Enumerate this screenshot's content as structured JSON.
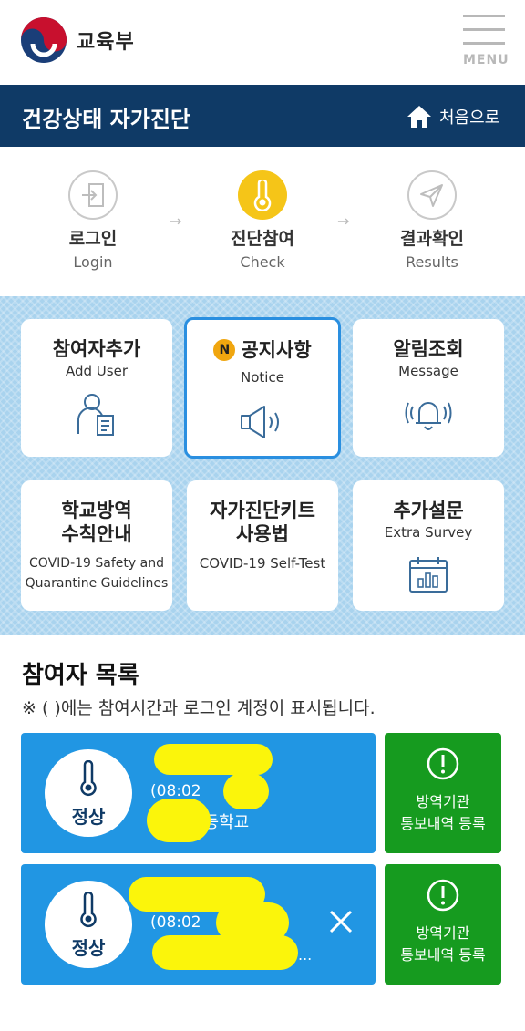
{
  "header": {
    "brand": "교육부",
    "menu_label": "MENU"
  },
  "titlebar": {
    "title": "건강상태 자가진단",
    "home_label": "처음으로"
  },
  "steps": [
    {
      "ko": "로그인",
      "en": "Login"
    },
    {
      "ko": "진단참여",
      "en": "Check"
    },
    {
      "ko": "결과확인",
      "en": "Results"
    }
  ],
  "step_arrow": "→",
  "cards": {
    "add_user": {
      "ko": "참여자추가",
      "en": "Add User"
    },
    "notice": {
      "badge": "N",
      "ko": "공지사항",
      "en": "Notice"
    },
    "message": {
      "ko": "알림조회",
      "en": "Message"
    },
    "safety": {
      "ko1": "학교방역",
      "ko2": "수칙안내",
      "en1": "COVID-19 Safety and",
      "en2": "Quarantine Guidelines"
    },
    "selftest": {
      "ko1": "자가진단키트",
      "ko2": "사용법",
      "en": "COVID-19 Self-Test"
    },
    "survey": {
      "ko": "추가설문",
      "en": "Extra Survey"
    }
  },
  "participants": {
    "title": "참여자 목록",
    "note": "※ ( )에는 참여시간과 로그인 계정이 표시됩니다.",
    "entries": [
      {
        "status": "정상",
        "time": "(08:02",
        "school": "초등학교",
        "ellipsis": ""
      },
      {
        "status": "정상",
        "time": "(08:02",
        "school": "",
        "ellipsis": "..."
      }
    ],
    "report_label_1": "방역기관",
    "report_label_2": "통보내역 등록"
  },
  "colors": {
    "navy": "#0f3a66",
    "accent_yellow": "#f5c518",
    "entry_blue": "#2196e3",
    "report_green": "#169b1f"
  }
}
